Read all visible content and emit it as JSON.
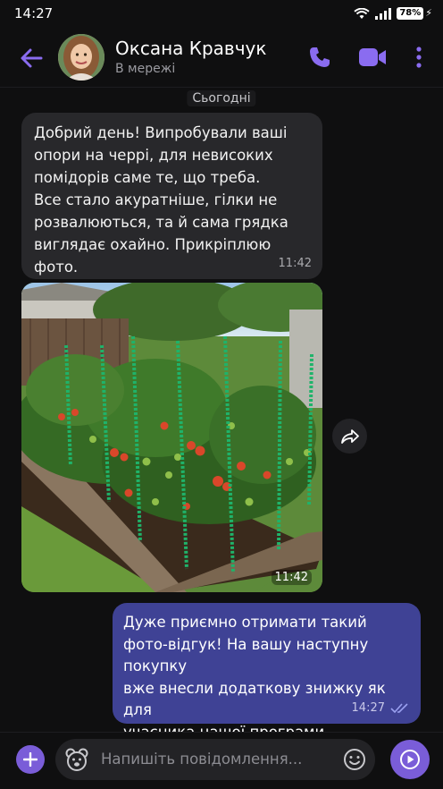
{
  "status_bar": {
    "time": "14:27",
    "battery": "78%"
  },
  "header": {
    "contact_name": "Оксана Кравчук",
    "contact_status": "В мережі",
    "icons": [
      "back-arrow-icon",
      "phone-icon",
      "video-camera-icon",
      "more-vertical-icon"
    ],
    "accent_color": "#8a6cf0"
  },
  "chat": {
    "date_separator": "Сьогодні",
    "messages": [
      {
        "direction": "incoming",
        "text": "Добрий день! Випробували ваші\nопори на черрі, для невисоких\nпомідорів саме те, що треба.\nВсе стало акуратніше, гілки не\nрозвалюються, та й сама грядка\nвиглядає охайно. Прикріплюю фото.",
        "time": "11:42"
      },
      {
        "direction": "incoming",
        "type": "photo",
        "photo_subject": "raised garden bed with cherry tomato plants on green support stakes",
        "time": "11:42"
      },
      {
        "direction": "outgoing",
        "text": "Дуже приємно отримати такий\nфото-відгук! На вашу наступну покупку\nвже внесли додаткову знижку як для\nучасника нашої програми лояльності 🍅",
        "time": "14:27",
        "status": "read"
      }
    ]
  },
  "input_bar": {
    "placeholder": "Напишіть повідомлення...",
    "icons": [
      "plus-icon",
      "sticker-bear-icon",
      "emoji-icon",
      "send-icon"
    ]
  },
  "colors": {
    "background": "#0f0f10",
    "incoming_bubble": "#28282b",
    "outgoing_bubble": "#3f4295",
    "accent": "#7a5dd8"
  }
}
